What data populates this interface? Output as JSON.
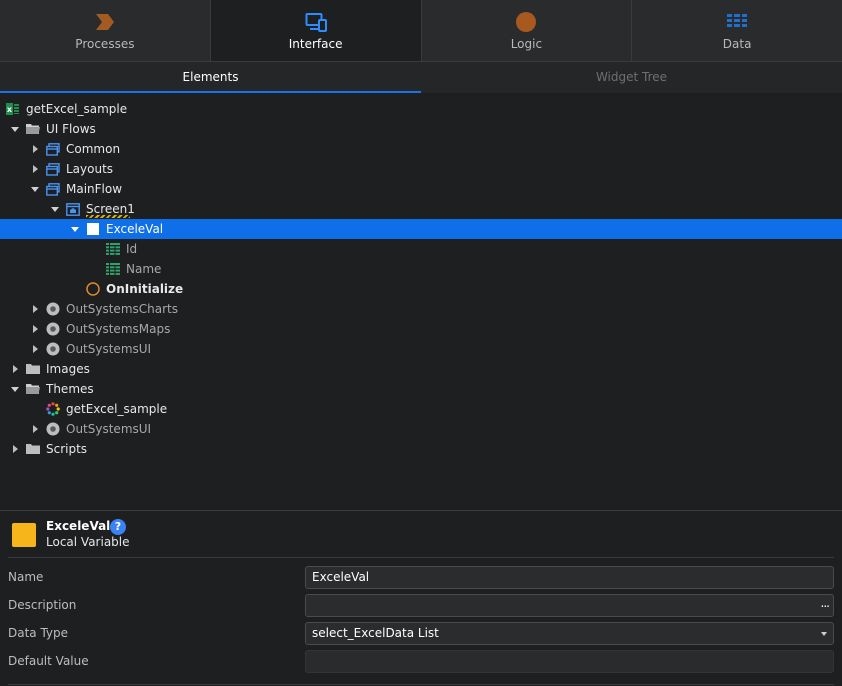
{
  "top_tabs": [
    {
      "label": "Processes",
      "icon": "processes-chevron-icon"
    },
    {
      "label": "Interface",
      "icon": "interface-devices-icon",
      "active": true
    },
    {
      "label": "Logic",
      "icon": "logic-circle-icon"
    },
    {
      "label": "Data",
      "icon": "data-grid-icon"
    }
  ],
  "sub_tabs": [
    {
      "label": "Elements",
      "active": true
    },
    {
      "label": "Widget Tree"
    }
  ],
  "tree": {
    "root": "getExcel_sample",
    "ui_flows": "UI Flows",
    "common": "Common",
    "layouts": "Layouts",
    "mainflow": "MainFlow",
    "screen1": "Screen1",
    "excelval": "ExceleVal",
    "id": "Id",
    "name": "Name",
    "oninitialize": "OnInitialize",
    "outsystemscharts": "OutSystemsCharts",
    "outsystemsmaps": "OutSystemsMaps",
    "outsystemsui": "OutSystemsUI",
    "images": "Images",
    "themes": "Themes",
    "theme_getexcel": "getExcel_sample",
    "theme_outsystemsui": "OutSystemsUI",
    "scripts": "Scripts"
  },
  "properties": {
    "title": "ExceleVal",
    "subtitle": "Local Variable",
    "name_label": "Name",
    "name_value": "ExceleVal",
    "description_label": "Description",
    "description_value": "",
    "description_button": "...",
    "datatype_label": "Data Type",
    "datatype_value": "select_ExcelData List",
    "default_label": "Default Value",
    "default_value": "",
    "help": "?"
  },
  "colors": {
    "accent": "#1a73e8",
    "selected_row": "#0f6fe8",
    "variable_swatch": "#f7b51c",
    "processes_icon": "#a35a23",
    "logic_icon": "#a7591f",
    "data_icon": "#1f6fcf"
  }
}
